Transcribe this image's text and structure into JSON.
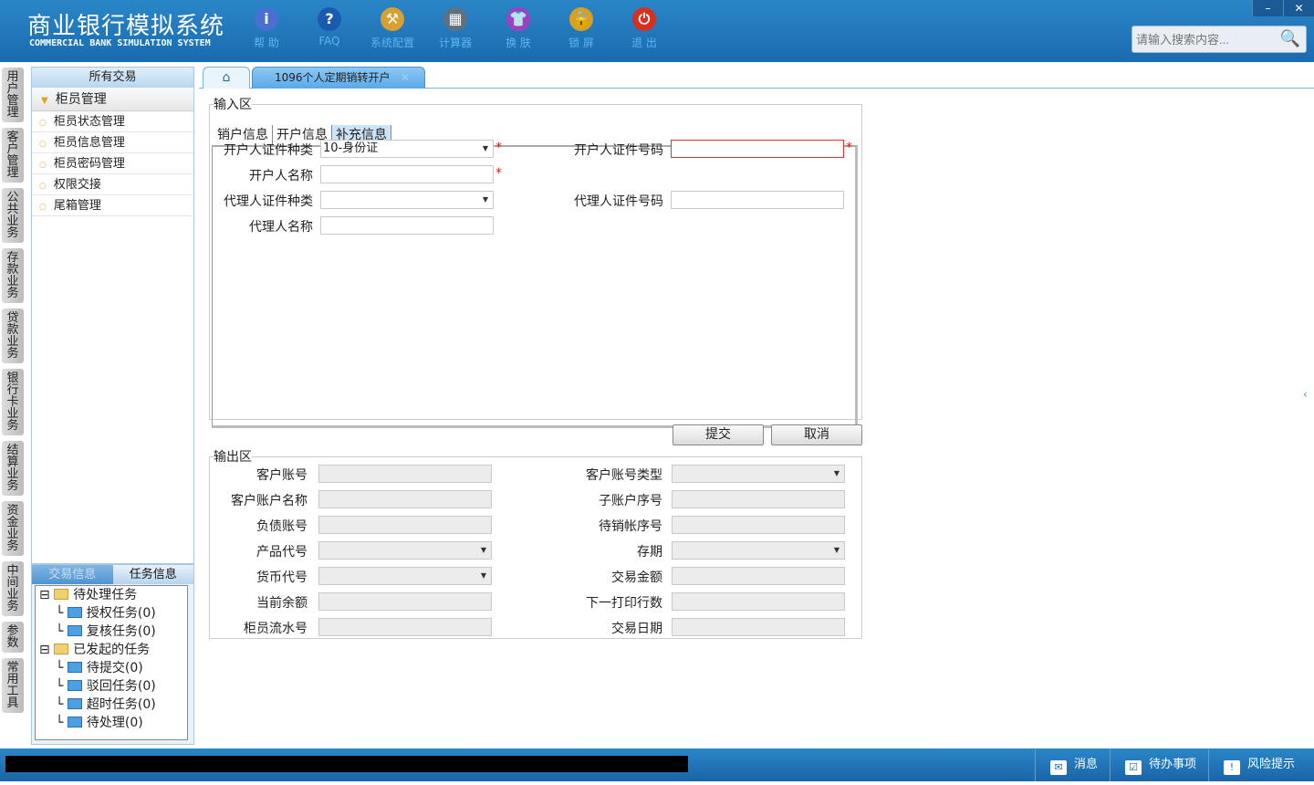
{
  "header": {
    "title_cn": "商业银行模拟系统",
    "title_en": "COMMERCIAL BANK SIMULATION SYSTEM",
    "tools": [
      {
        "label": "帮 助",
        "icon": "info-icon",
        "color": "#4a6fd0",
        "glyph": "i"
      },
      {
        "label": "FAQ",
        "icon": "question-icon",
        "color": "#1a5ab0",
        "glyph": "?"
      },
      {
        "label": "系统配置",
        "icon": "toolbox-icon",
        "color": "#d8a030",
        "glyph": "⚒"
      },
      {
        "label": "计算器",
        "icon": "calculator-icon",
        "color": "#607080",
        "glyph": "▦"
      },
      {
        "label": "换 肤",
        "icon": "shirt-icon",
        "color": "#a040c0",
        "glyph": "👕"
      },
      {
        "label": "锁 屏",
        "icon": "lock-icon",
        "color": "#d8a020",
        "glyph": "🔒"
      },
      {
        "label": "退 出",
        "icon": "power-icon",
        "color": "#d83020",
        "glyph": "⏻"
      }
    ],
    "search_placeholder": "请输入搜索内容...",
    "window_buttons": [
      "–",
      "✕"
    ]
  },
  "vtabs": [
    "用户管理",
    "客户管理",
    "公共业务",
    "存款业务",
    "贷款业务",
    "银行卡业务",
    "结算业务",
    "资金业务",
    "中间业务",
    "参数",
    "常用工具"
  ],
  "sidebar": {
    "header": "所有交易",
    "group": "柜员管理",
    "items": [
      "柜员状态管理",
      "柜员信息管理",
      "柜员密码管理",
      "权限交接",
      "尾箱管理"
    ]
  },
  "task_panel": {
    "tabs": [
      "交易信息",
      "任务信息"
    ],
    "tree": [
      {
        "label": "待处理任务",
        "level": 0
      },
      {
        "label": "授权任务(0)",
        "level": 1
      },
      {
        "label": "复核任务(0)",
        "level": 1
      },
      {
        "label": "已发起的任务",
        "level": 0
      },
      {
        "label": "待提交(0)",
        "level": 1
      },
      {
        "label": "驳回任务(0)",
        "level": 1
      },
      {
        "label": "超时任务(0)",
        "level": 1
      },
      {
        "label": "待处理(0)",
        "level": 1
      }
    ]
  },
  "tabs": {
    "active": "1096个人定期销转开户"
  },
  "input_area": {
    "legend": "输入区",
    "tabs": [
      "销户信息",
      "开户信息",
      "补充信息"
    ],
    "active_tab": "补充信息",
    "fields": {
      "id_type_label": "开户人证件种类",
      "id_type_value": "10-身份证",
      "id_no_label": "开户人证件号码",
      "id_no_value": "",
      "name_label": "开户人名称",
      "name_value": "",
      "agent_id_type_label": "代理人证件种类",
      "agent_id_type_value": "",
      "agent_id_no_label": "代理人证件号码",
      "agent_id_no_value": "",
      "agent_name_label": "代理人名称",
      "agent_name_value": ""
    },
    "required_mark": "*"
  },
  "buttons": {
    "submit": "提交",
    "cancel": "取消"
  },
  "output_area": {
    "legend": "输出区",
    "left": [
      {
        "label": "客户账号"
      },
      {
        "label": "客户账户名称"
      },
      {
        "label": "负债账号"
      },
      {
        "label": "产品代号",
        "dropdown": true
      },
      {
        "label": "货币代号",
        "dropdown": true
      },
      {
        "label": "当前余额"
      },
      {
        "label": "柜员流水号"
      }
    ],
    "right": [
      {
        "label": "客户账号类型",
        "dropdown": true
      },
      {
        "label": "子账户序号"
      },
      {
        "label": "待销帐序号"
      },
      {
        "label": "存期",
        "dropdown": true
      },
      {
        "label": "交易金额"
      },
      {
        "label": "下一打印行数"
      },
      {
        "label": "交易日期"
      }
    ]
  },
  "statusbar": {
    "items": [
      {
        "label": "消息",
        "icon": "mail-icon"
      },
      {
        "label": "待办事项",
        "icon": "checkbox-icon"
      },
      {
        "label": "风险提示",
        "icon": "alert-bubble-icon"
      }
    ]
  }
}
